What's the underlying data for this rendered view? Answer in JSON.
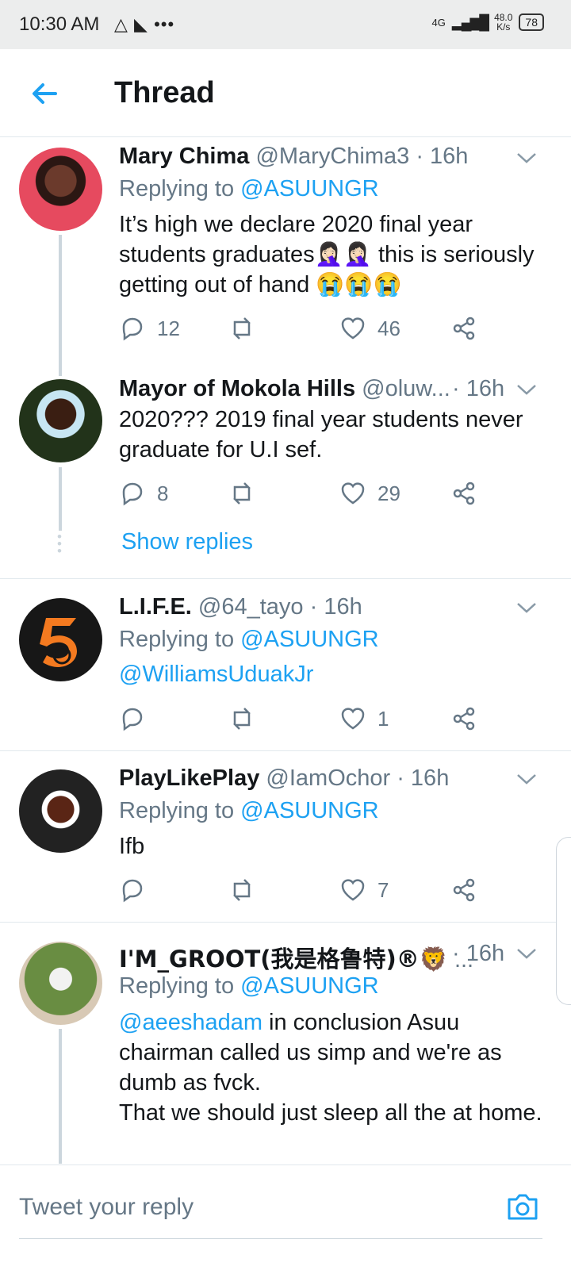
{
  "statusbar": {
    "time": "10:30 AM",
    "icons": "△ ◣ •••",
    "network_type": "4G",
    "speed_value": "48.0",
    "speed_unit": "K/s",
    "battery": "78"
  },
  "header": {
    "title": "Thread"
  },
  "tweets": [
    {
      "name": "Mary Chima",
      "handle": "@MaryChima3 · 16h",
      "replying": "Replying to ",
      "reply_to": "@ASUUNGR",
      "text": "It’s high we declare 2020 final year students graduates🤦🏻‍♀️🤦🏻‍♀️ this is seriously getting out of hand 😭😭😭",
      "replies": "12",
      "likes": "46"
    },
    {
      "name": "Mayor of Mokola Hills",
      "handle": "@oluw...",
      "time": "· 16h",
      "text": "2020??? 2019 final year students never graduate for U.I sef.",
      "replies": "8",
      "likes": "29"
    },
    {
      "name": "L.I.F.E.",
      "handle": "@64_tayo · 16h",
      "replying": "Replying to ",
      "reply_to": "@ASUUNGR",
      "mention": "@WilliamsUduakJr",
      "likes": "1"
    },
    {
      "name": "PlayLikePlay",
      "handle": "@IamOchor · 16h",
      "replying": "Replying to ",
      "reply_to": "@ASUUNGR",
      "text": "Ifb",
      "likes": "7"
    },
    {
      "name": "I'M_GROOT(我是格鲁特)®🦁",
      "handle": "...",
      "time": "· 16h",
      "replying": "Replying to ",
      "reply_to": "@ASUUNGR",
      "mention": "@aeeshadam",
      "text": " in conclusion Asuu chairman called us simp and we're as dumb as fvck.",
      "text2": "That we should just sleep all the at home."
    }
  ],
  "show_replies": "Show replies",
  "composer": {
    "placeholder": "Tweet your reply"
  }
}
